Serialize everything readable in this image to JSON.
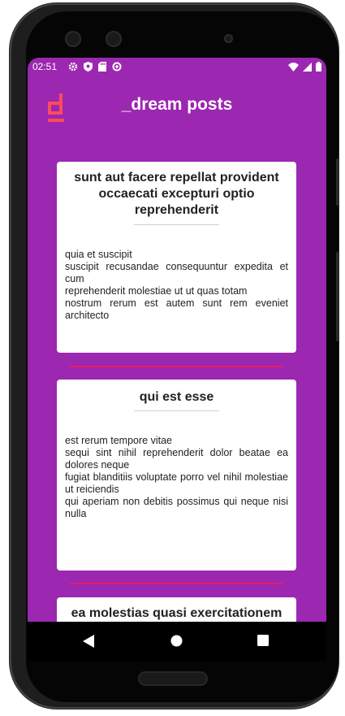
{
  "status_bar": {
    "time": "02:51",
    "left_icons": [
      "gear-icon",
      "shield-icon",
      "sd-card-icon",
      "data-saver-icon"
    ],
    "right_icons": [
      "wifi-icon",
      "signal-icon",
      "battery-icon"
    ]
  },
  "app_bar": {
    "logo_icon": "d-logo-icon",
    "title": "_dream posts"
  },
  "posts": [
    {
      "title": "sunt aut facere repellat provident occaecati excepturi optio reprehenderit",
      "body_lines": [
        "quia et suscipit",
        "suscipit recusandae consequuntur expedita et cum",
        "reprehenderit molestiae ut ut quas totam",
        "nostrum rerum est autem sunt rem eveniet architecto"
      ]
    },
    {
      "title": "qui est esse",
      "body_lines": [
        "est rerum tempore vitae",
        "sequi sint nihil reprehenderit dolor beatae ea dolores neque",
        "fugiat blanditiis voluptate porro vel nihil molestiae ut reiciendis",
        "qui aperiam non debitis possimus qui neque nisi nulla"
      ]
    },
    {
      "title": "ea molestias quasi exercitationem"
    }
  ],
  "nav_bar": {
    "icons": [
      "back-icon",
      "home-icon",
      "recents-icon"
    ]
  },
  "colors": {
    "app_background": "#9c27b0",
    "accent": "#e91e63",
    "card": "#ffffff"
  }
}
